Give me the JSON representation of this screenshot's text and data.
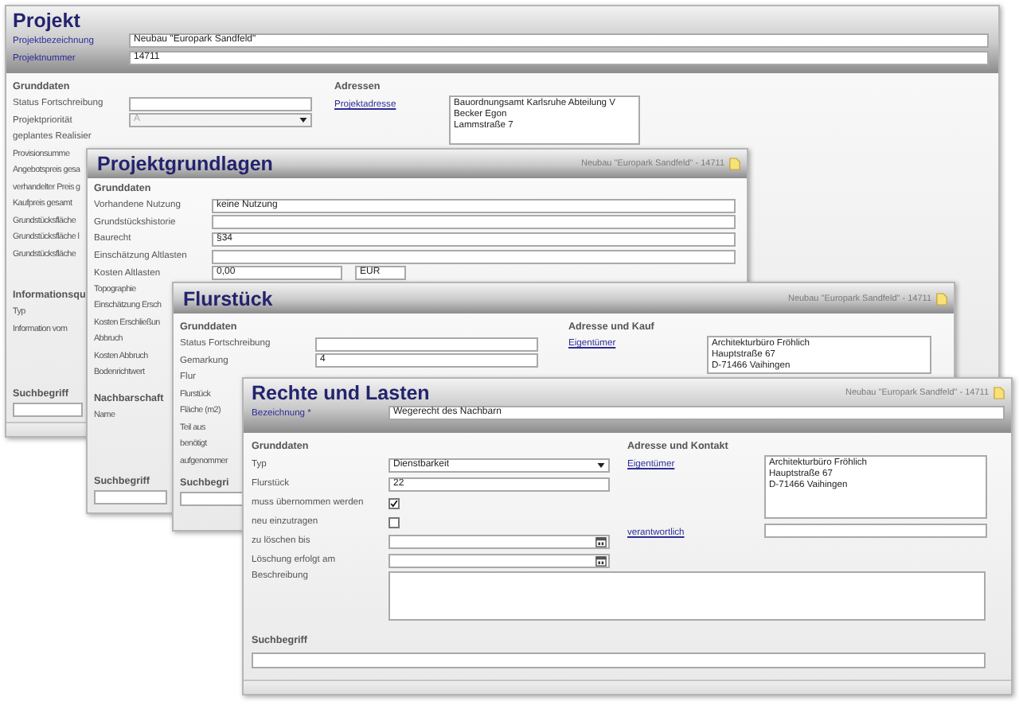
{
  "projekt": {
    "title": "Projekt",
    "header_fields": [
      {
        "label": "Projektbezeichnung",
        "value": "Neubau \"Europark Sandfeld\""
      },
      {
        "label": "Projektnummer",
        "value": "14711"
      }
    ],
    "grunddaten": {
      "heading": "Grunddaten",
      "rows": [
        {
          "label": "Status Fortschreibung",
          "kind": "text"
        },
        {
          "label": "Projektpriorität",
          "kind": "select",
          "value": "A",
          "disabled": true
        },
        {
          "label": "geplantes Realisier",
          "kind": "none"
        }
      ]
    },
    "covered_labels": [
      "Provisionsumme",
      "Angebotspreis gesa",
      "verhandelter Preis g",
      "Kaufpreis gesamt",
      "Grundstücksfläche",
      "Grundstücksfläche l",
      "Grundstücksfläche"
    ],
    "information": {
      "heading": "Informationsqu",
      "labels": [
        "Typ",
        "Information vom"
      ]
    },
    "search": {
      "heading": "Suchbegriff"
    },
    "addresses": {
      "heading": "Adressen",
      "link": "Projektadresse",
      "lines": [
        "Bauordnungsamt Karlsruhe Abteilung V",
        "Becker Egon",
        "Lammstraße 7"
      ]
    }
  },
  "projektgrundlagen": {
    "title": "Projektgrundlagen",
    "context": "Neubau \"Europark Sandfeld\" - 14711",
    "heading": "Grunddaten",
    "rows": [
      {
        "label": "Vorhandene Nutzung",
        "kind": "text",
        "value": "keine Nutzung"
      },
      {
        "label": "Grundstückshistorie",
        "kind": "text"
      },
      {
        "label": "Baurecht",
        "kind": "text",
        "value": "§34"
      },
      {
        "label": "Einschätzung Altlasten",
        "kind": "text"
      },
      {
        "label": "Kosten Altlasten",
        "kind": "currency",
        "value": "0,00",
        "unit": "EUR"
      }
    ],
    "covered_labels": [
      "Topographie",
      "Einschätzung Ersch",
      "Kosten Erschließun",
      "Abbruch",
      "Kosten Abbruch",
      "Bodenrichtwert"
    ],
    "neighbourhood": {
      "heading": "Nachbarschaft",
      "labels": [
        "Name"
      ]
    },
    "search": {
      "heading": "Suchbegriff"
    }
  },
  "flurstueck": {
    "title": "Flurstück",
    "context": "Neubau \"Europark Sandfeld\" - 14711",
    "heading": "Grunddaten",
    "rows": [
      {
        "label": "Status Fortschreibung",
        "kind": "text"
      },
      {
        "label": "Gemarkung",
        "kind": "text",
        "value": "4"
      },
      {
        "label": "Flur",
        "kind": "none"
      }
    ],
    "covered_labels": [
      "Flurstück",
      "Fläche (m2)",
      "Teil aus",
      "benötigt",
      "aufgenommer"
    ],
    "search": {
      "heading": "Suchbegri"
    },
    "address": {
      "heading": "Adresse und Kauf",
      "link": "Eigentümer",
      "lines": [
        "Architekturbüro Fröhlich",
        "Hauptstraße 67",
        "D-71466 Vaihingen"
      ]
    }
  },
  "rechte_und_lasten": {
    "title": "Rechte und Lasten",
    "context": "Neubau \"Europark Sandfeld\" - 14711",
    "name_field": {
      "label": "Bezeichnung *",
      "value": "Wegerecht des Nachbarn"
    },
    "heading": "Grunddaten",
    "rows": [
      {
        "label": "Typ",
        "kind": "select",
        "value": "Dienstbarkeit",
        "disabled": false
      },
      {
        "label": "Flurstück",
        "kind": "text",
        "value": "22"
      },
      {
        "label": "muss übernommen werden",
        "kind": "checkbox",
        "checked": true
      },
      {
        "label": "neu einzutragen",
        "kind": "checkbox",
        "checked": false
      },
      {
        "label": "zu löschen bis",
        "kind": "date"
      },
      {
        "label": "Löschung erfolgt am",
        "kind": "date"
      }
    ],
    "description": {
      "label": "Beschreibung"
    },
    "contact": {
      "heading": "Adresse und Kontakt",
      "owner_link": "Eigentümer",
      "owner_lines": [
        "Architekturbüro Fröhlich",
        "Hauptstraße 67",
        "D-71466 Vaihingen"
      ],
      "responsible_link": "verantwortlich"
    },
    "search": {
      "heading": "Suchbegriff"
    }
  }
}
